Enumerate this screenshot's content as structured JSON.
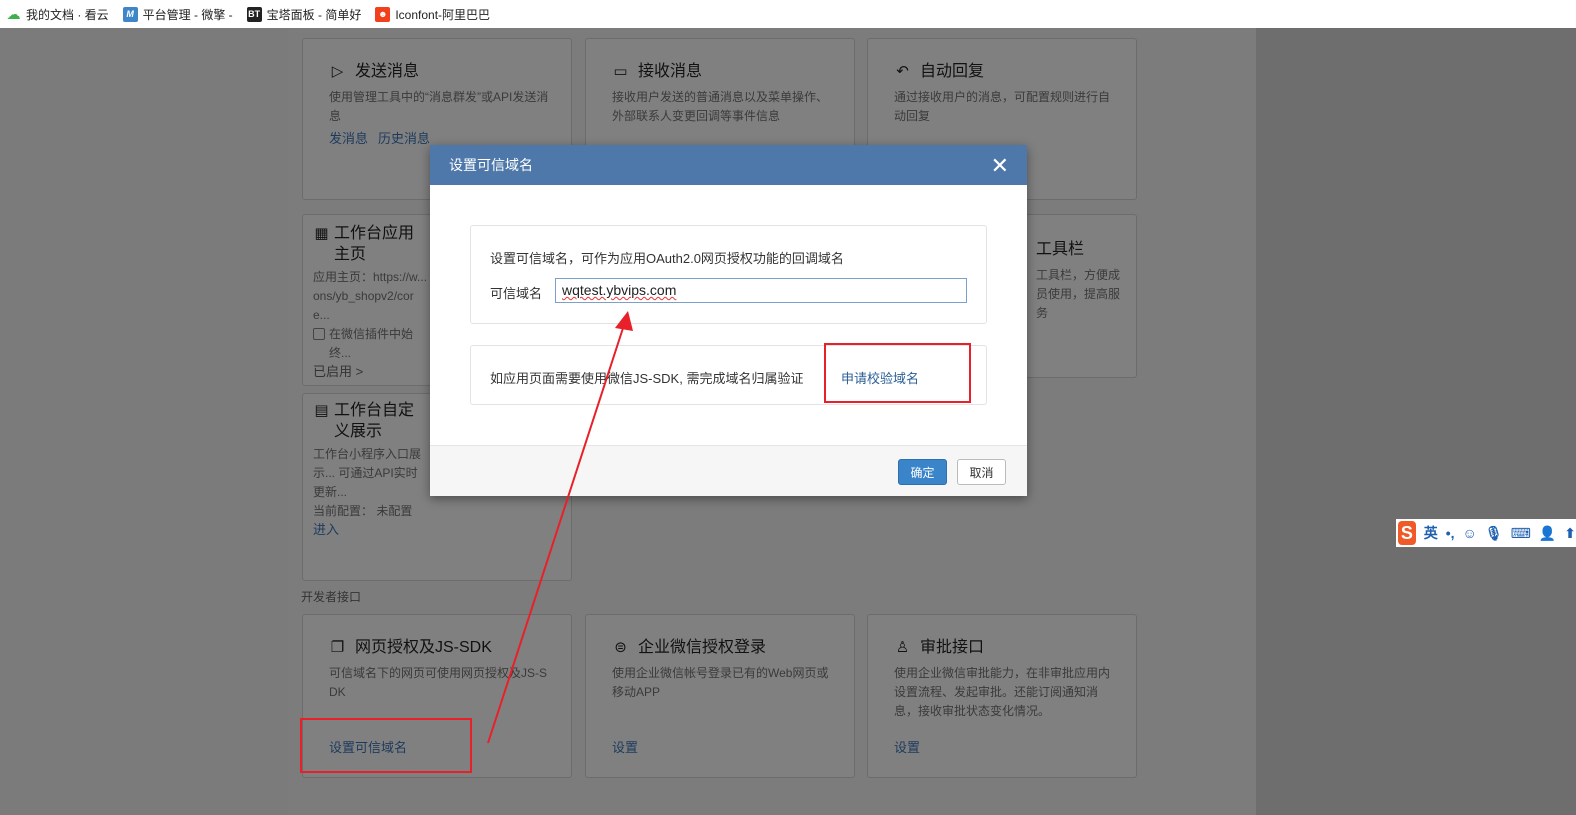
{
  "bookmarks": [
    {
      "label": "我的文档 · 看云",
      "icon": "cloud-icon",
      "color": "#3cb04a"
    },
    {
      "label": "平台管理 - 微擎 -",
      "icon": "M",
      "color": "#3f86c9"
    },
    {
      "label": "宝塔面板 - 简单好",
      "icon": "BT",
      "color": "#222222"
    },
    {
      "label": "Iconfont-阿里巴巴",
      "icon": "skull-icon",
      "color": "#f0401c"
    }
  ],
  "cards": [
    {
      "title": "发送消息",
      "icon": "send-icon",
      "desc": "使用管理工具中的“消息群发”或API发送消息",
      "links": [
        "发消息",
        "历史消息"
      ]
    },
    {
      "title": "接收消息",
      "icon": "chat-icon",
      "desc": "接收用户发送的普通消息以及菜单操作、外部联系人变更回调等事件信息",
      "links": []
    },
    {
      "title": "自动回复",
      "icon": "reply-icon",
      "desc": "通过接收用户的消息，可配置规则进行自动回复",
      "links": []
    },
    {
      "title": "工作台应用主页",
      "icon": "grid-icon",
      "desc": "应用主页：https://w... ons/yb_shopv2/core...",
      "checkbox": "在微信插件中始终...",
      "status": "已启用 >"
    },
    {
      "title": "工具栏",
      "desc": "工具栏，方便成员使用，提高服务"
    },
    {
      "title": "工作台自定义展示",
      "icon": "card-icon",
      "desc": "工作台小程序入口展示... 可通过API实时更新...",
      "config": "当前配置： 未配置",
      "links": [
        "进入"
      ]
    }
  ],
  "dev_section": {
    "label": "开发者接口",
    "cards": [
      {
        "title": "网页授权及JS-SDK",
        "icon": "copy-icon",
        "desc": "可信域名下的网页可使用网页授权及JS-SDK",
        "link": "设置可信域名"
      },
      {
        "title": "企业微信授权登录",
        "icon": "login-icon",
        "desc": "使用企业微信帐号登录已有的Web网页或移动APP",
        "link": "设置"
      },
      {
        "title": "审批接口",
        "icon": "stamp-icon",
        "desc": "使用企业微信审批能力，在非审批应用内设置流程、发起审批。还能订阅通知消息，接收审批状态变化情况。",
        "link": "设置"
      }
    ]
  },
  "dialog": {
    "title": "设置可信域名",
    "intro": "设置可信域名，可作为应用OAuth2.0网页授权功能的回调域名",
    "field_label": "可信域名",
    "field_value": "wqtest.ybvips.com",
    "jssdk_text": "如应用页面需要使用微信JS-SDK, 需完成域名归属验证",
    "jssdk_link": "申请校验域名",
    "ok": "确定",
    "cancel": "取消"
  },
  "ime": {
    "mode": "英",
    "items": [
      "punct-icon",
      "emoji-icon",
      "mic-icon",
      "keyboard-icon",
      "user-icon",
      "arrow-icon"
    ]
  }
}
